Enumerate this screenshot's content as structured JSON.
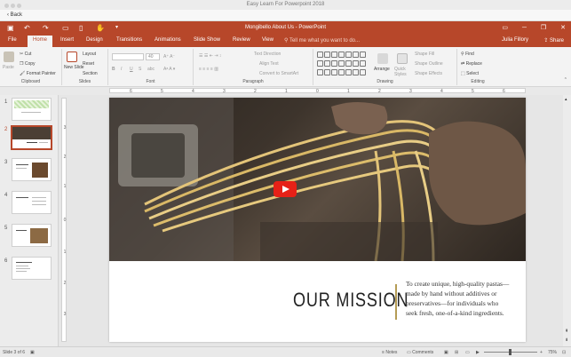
{
  "outer_window": {
    "title": "Easy Learn For Powerpoint 2018",
    "back": "Back"
  },
  "titlebar": {
    "doc_title": "Mongibello About Us - PowerPoint"
  },
  "tabs": [
    {
      "label": "File"
    },
    {
      "label": "Home",
      "active": true
    },
    {
      "label": "Insert"
    },
    {
      "label": "Design"
    },
    {
      "label": "Transitions"
    },
    {
      "label": "Animations"
    },
    {
      "label": "Slide Show"
    },
    {
      "label": "Review"
    },
    {
      "label": "View"
    }
  ],
  "tell_me": "Tell me what you want to do...",
  "user": "Julia Fillory",
  "share": "Share",
  "ribbon": {
    "clipboard": {
      "label": "Clipboard",
      "paste": "Paste",
      "cut": "Cut",
      "copy": "Copy",
      "format_painter": "Format Painter"
    },
    "slides": {
      "label": "Slides",
      "new_slide": "New Slide",
      "layout": "Layout",
      "reset": "Reset",
      "section": "Section"
    },
    "font": {
      "label": "Font",
      "size": "40",
      "bold": "B",
      "italic": "I",
      "underline": "U",
      "strike": "S",
      "abc": "abc"
    },
    "paragraph": {
      "label": "Paragraph",
      "text_direction": "Text Direction",
      "align_text": "Align Text",
      "convert": "Convert to SmartArt"
    },
    "drawing": {
      "label": "Drawing",
      "arrange": "Arrange",
      "quick_styles": "Quick Styles",
      "shape_fill": "Shape Fill",
      "shape_outline": "Shape Outline",
      "shape_effects": "Shape Effects"
    },
    "editing": {
      "label": "Editing",
      "find": "Find",
      "replace": "Replace",
      "select": "Select"
    }
  },
  "ruler": {
    "ticks": [
      "6",
      "5",
      "4",
      "3",
      "2",
      "1",
      "0",
      "1",
      "2",
      "3",
      "4",
      "5",
      "6"
    ]
  },
  "vruler": {
    "ticks": [
      "3",
      "2",
      "1",
      "0",
      "1",
      "2",
      "3"
    ]
  },
  "thumbnails": [
    {
      "num": "1"
    },
    {
      "num": "2",
      "selected": true
    },
    {
      "num": "3"
    },
    {
      "num": "4"
    },
    {
      "num": "5"
    },
    {
      "num": "6"
    }
  ],
  "slide": {
    "heading": "OUR MISSION",
    "body": "To create unique, high-quality pastas—made by hand without additives or preservatives—for individuals who seek fresh, one-of-a-kind ingredients."
  },
  "status": {
    "slide_info": "Slide 3 of 6",
    "notes": "Notes",
    "comments": "Comments",
    "zoom": "75%"
  },
  "colors": {
    "accent": "#b7472a",
    "divider": "#b59c55",
    "play": "#e62117"
  }
}
